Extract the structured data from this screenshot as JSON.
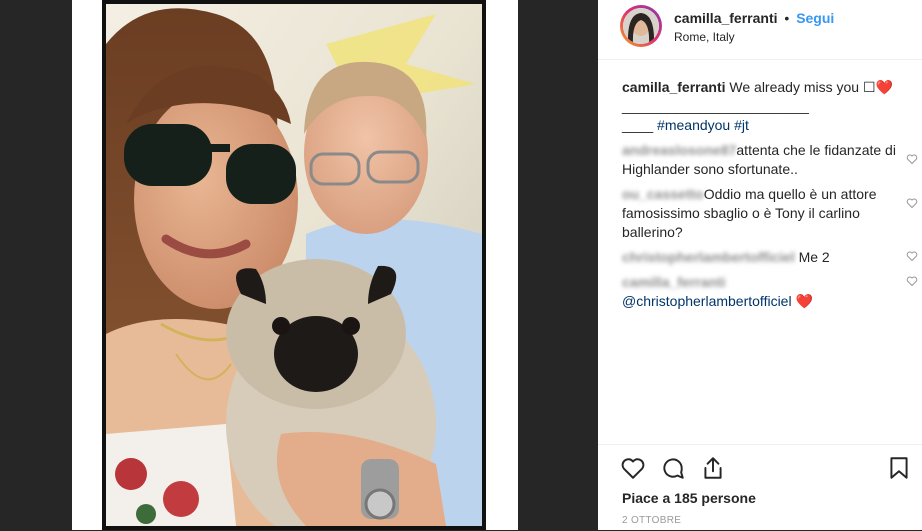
{
  "post": {
    "username": "camilla_ferranti",
    "separator": "•",
    "follow_label": "Segui",
    "location": "Rome, Italy"
  },
  "caption": {
    "username": "camilla_ferranti",
    "text": "We already miss you ☐",
    "heart": "❤️",
    "underline": "________________________",
    "underline2": "____",
    "hashtags": "#meandyou #jt"
  },
  "comments": [
    {
      "username": "andreaslosone87",
      "text": "attenta che le fidanzate di Highlander sono sfortunate..",
      "liked": false
    },
    {
      "username": "ou_cassetto",
      "text": "Oddio ma quello è un attore famosissimo sbaglio o è Tony il carlino ballerino?",
      "liked": false
    },
    {
      "username": "christopherlambertofficiel",
      "text": "Me 2",
      "liked": false
    },
    {
      "username": "camilla_ferranti",
      "text": "@christopherlambertofficiel",
      "heart": "❤️",
      "liked": false
    }
  ],
  "footer": {
    "likes": "Piace a 185 persone",
    "date": "2 OTTOBRE"
  },
  "icons": {
    "like": "heart-outline",
    "comment": "speech-bubble",
    "share": "upload-arrow",
    "save": "bookmark"
  },
  "colors": {
    "accent": "#3897f0",
    "hashtag": "#003569",
    "heart": "#e0245e",
    "background": "#262626"
  }
}
